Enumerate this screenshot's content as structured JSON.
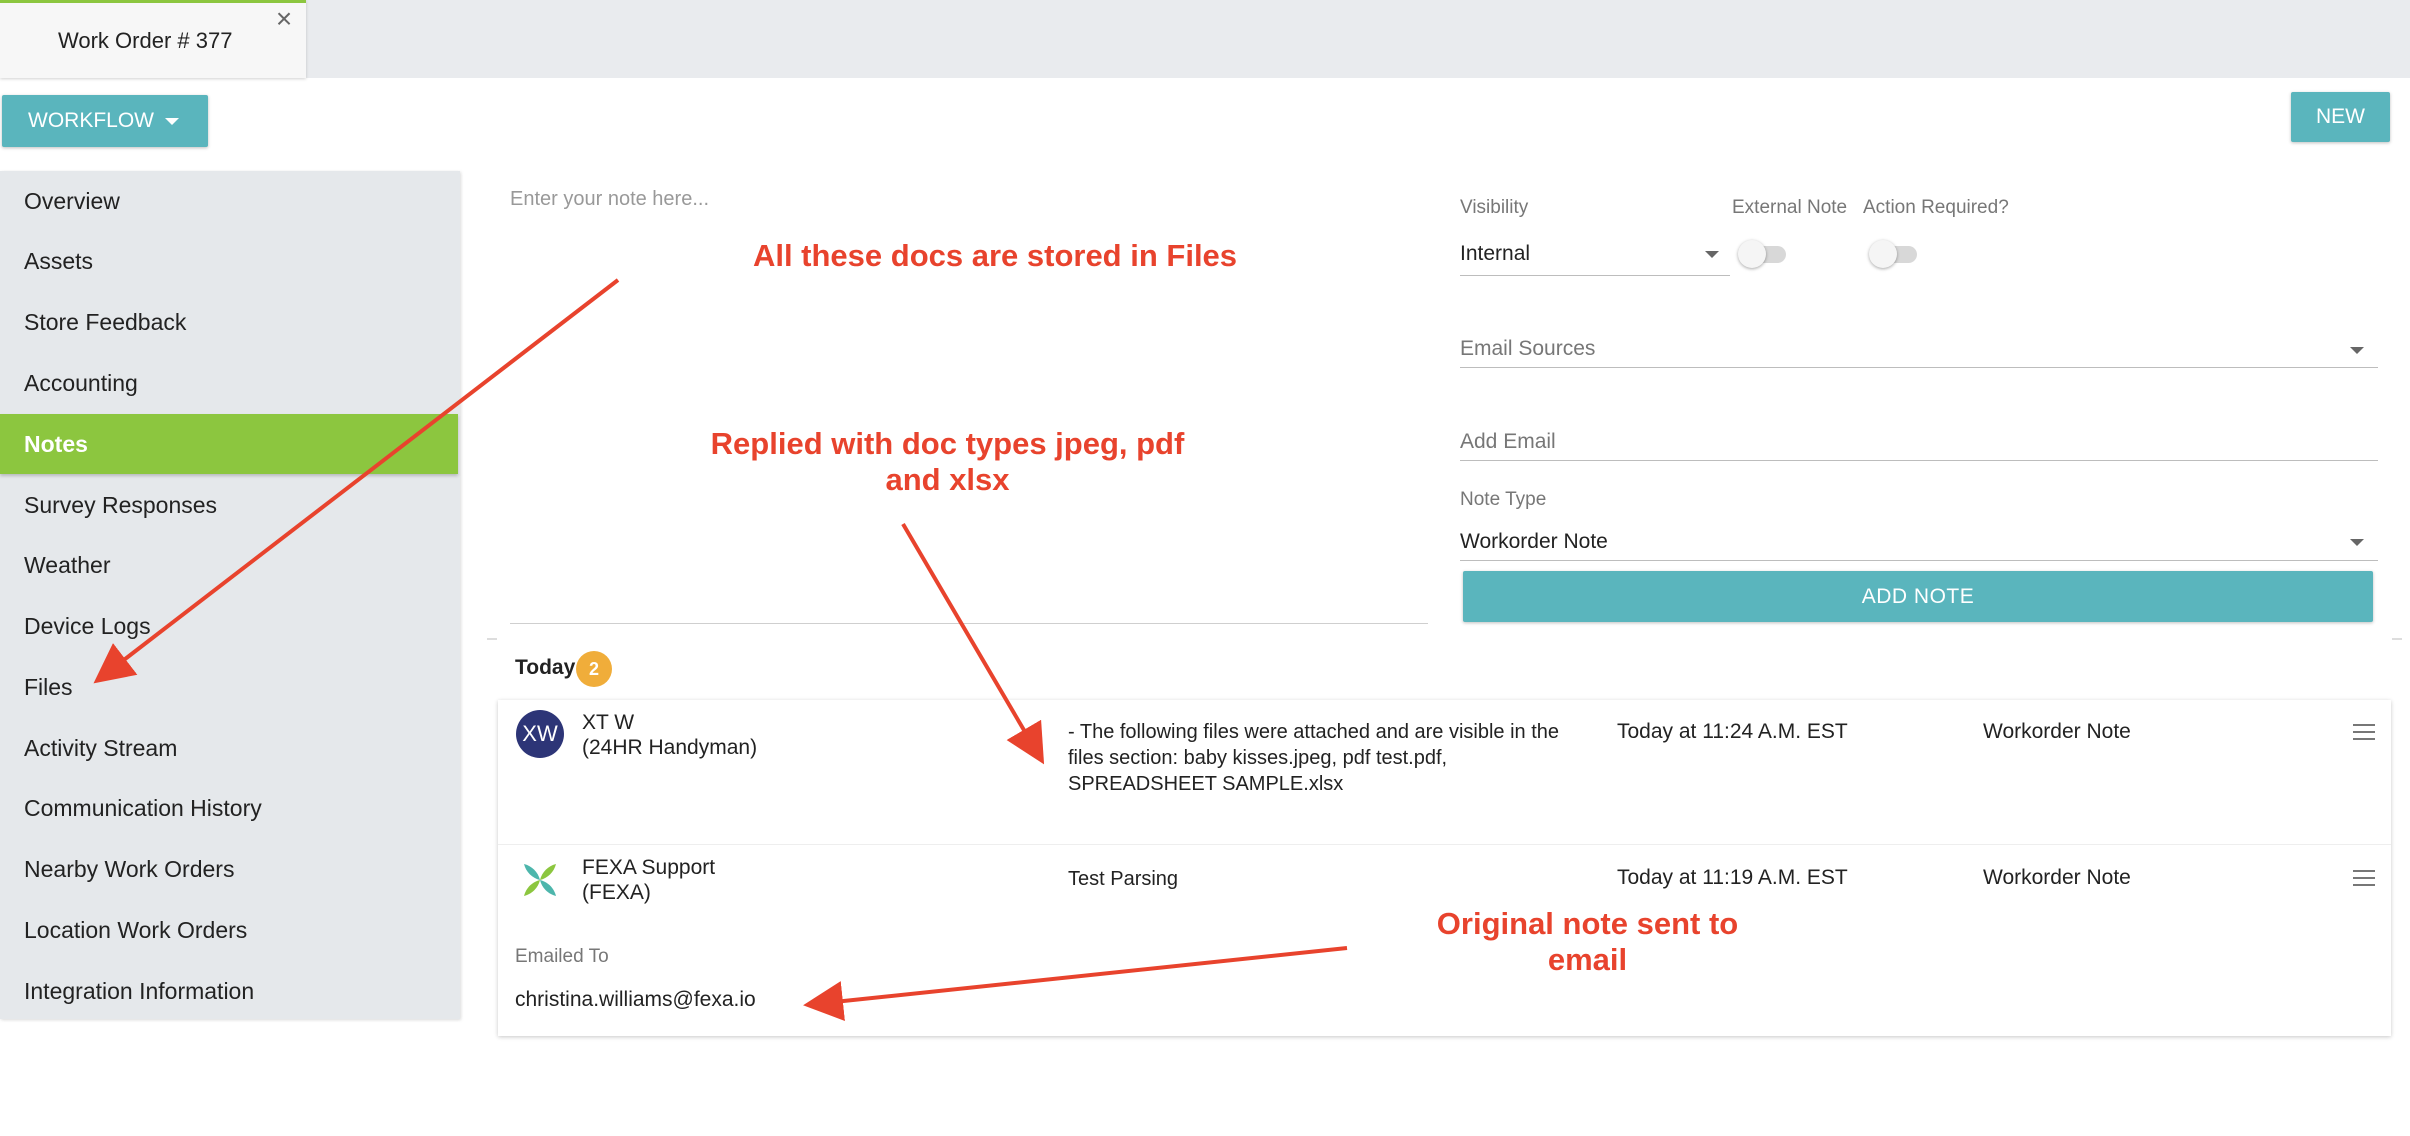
{
  "tab": {
    "title": "Work Order # 377"
  },
  "toolbar": {
    "workflow_label": "WORKFLOW",
    "new_label": "NEW"
  },
  "sidebar": {
    "items": [
      {
        "label": "Overview",
        "active": false
      },
      {
        "label": "Assets",
        "active": false
      },
      {
        "label": "Store Feedback",
        "active": false
      },
      {
        "label": "Accounting",
        "active": false
      },
      {
        "label": "Notes",
        "active": true
      },
      {
        "label": "Survey Responses",
        "active": false
      },
      {
        "label": "Weather",
        "active": false
      },
      {
        "label": "Device Logs",
        "active": false
      },
      {
        "label": "Files",
        "active": false
      },
      {
        "label": "Activity Stream",
        "active": false
      },
      {
        "label": "Communication History",
        "active": false
      },
      {
        "label": "Nearby Work Orders",
        "active": false
      },
      {
        "label": "Location Work Orders",
        "active": false
      },
      {
        "label": "Integration Information",
        "active": false
      }
    ]
  },
  "editor": {
    "note_placeholder": "Enter your note here...",
    "visibility_label": "Visibility",
    "visibility_value": "Internal",
    "external_note_label": "External Note",
    "external_note_on": false,
    "action_required_label": "Action Required?",
    "action_required_on": false,
    "email_sources_placeholder": "Email Sources",
    "add_email_placeholder": "Add Email",
    "note_type_label": "Note Type",
    "note_type_value": "Workorder Note",
    "add_note_label": "ADD NOTE"
  },
  "notes": {
    "group_label": "Today",
    "group_count": "2",
    "items": [
      {
        "avatar_initials": "XW",
        "author_name": "XT W",
        "author_org": "(24HR Handyman)",
        "text": "- The following files were attached and are visible in the files section: baby kisses.jpeg, pdf test.pdf, SPREADSHEET SAMPLE.xlsx",
        "time": "Today at 11:24 A.M. EST",
        "type": "Workorder Note"
      },
      {
        "avatar_icon": "fexa-logo-icon",
        "author_name": "FEXA Support",
        "author_org": "(FEXA)",
        "text": "Test Parsing",
        "time": "Today at 11:19 A.M. EST",
        "type": "Workorder Note",
        "emailed_to_label": "Emailed To",
        "emailed_to_value": "christina.williams@fexa.io"
      }
    ]
  },
  "annotations": {
    "files_note": "All these docs are stored in Files",
    "reply_note": "Replied with doc types jpeg, pdf and xlsx",
    "email_note": "Original note sent to email",
    "color": "#e8432d"
  },
  "colors": {
    "accent_teal": "#5ab5bd",
    "active_green": "#8cc63f",
    "badge_orange": "#f0ad3a",
    "avatar_navy": "#2d3577"
  }
}
